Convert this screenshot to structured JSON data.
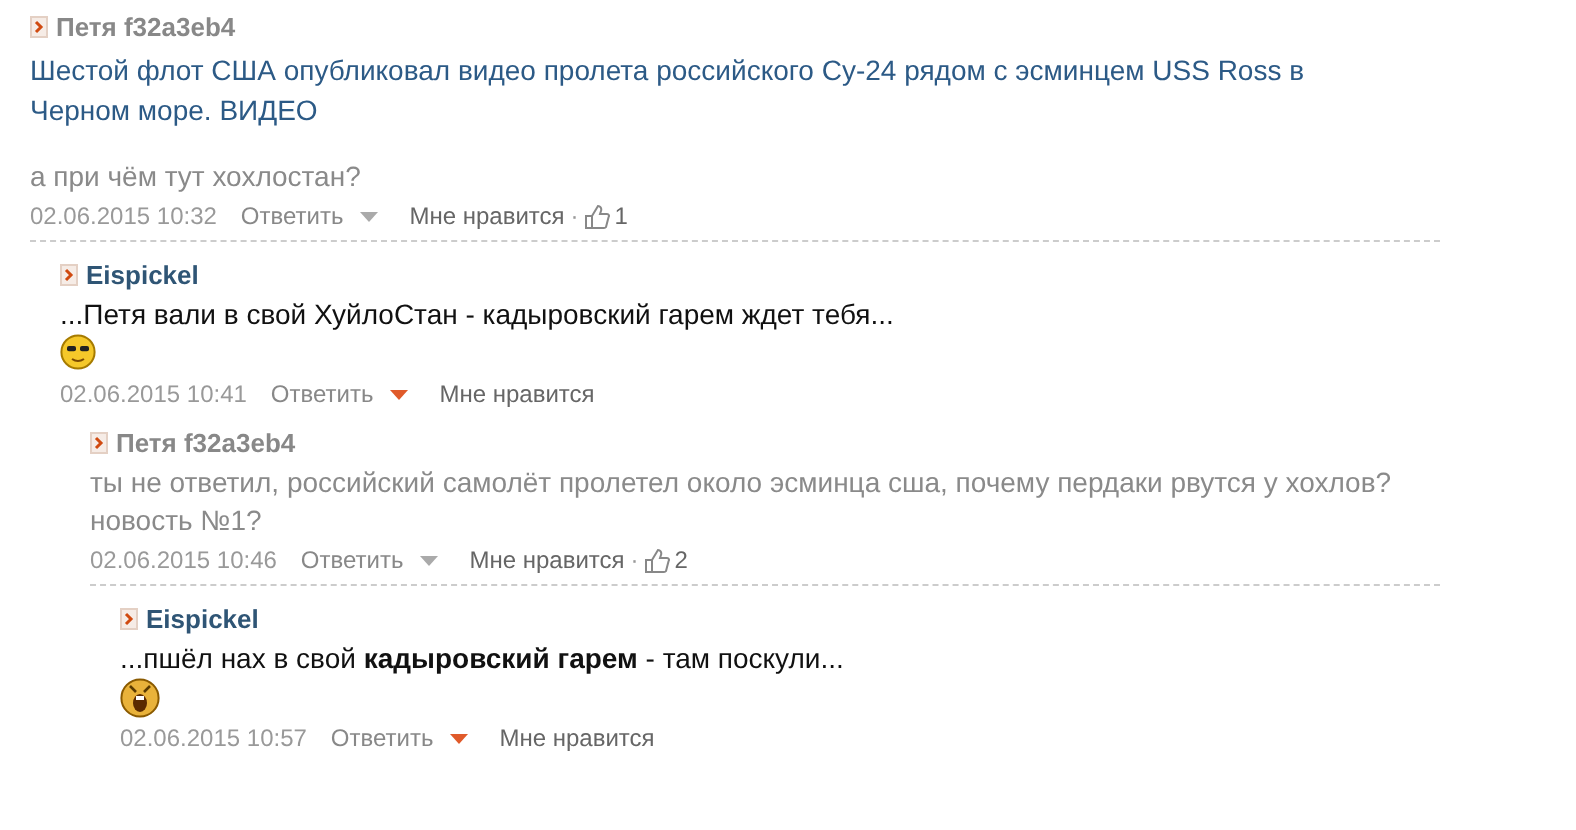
{
  "comments": [
    {
      "kind": "guest",
      "author": "Петя f32a3eb4",
      "link": "Шестой флот США опубликовал видео пролета российского Су-24 рядом с эсминцем USS Ross в Черном море. ВИДЕО",
      "text": "а при чём тут хохлостан?",
      "time": "02.06.2015 10:32",
      "reply": "Ответить",
      "like": "Мне нравится",
      "separator": "·",
      "likes": "1",
      "children": [
        {
          "kind": "member",
          "author": "Eispickel",
          "text": "...Петя вали в свой ХуйлоСтан - кадыровский гарем ждет тебя...",
          "smiley": {
            "kind": "cool"
          },
          "time": "02.06.2015 10:41",
          "reply": "Ответить",
          "like": "Мне нравится",
          "children": [
            {
              "kind": "guest",
              "author": "Петя f32a3eb4",
              "text": "ты не ответил, российский самолёт пролетел около эсминца сша, почему пердаки рвутся у хохлов? новость №1?",
              "time": "02.06.2015 10:46",
              "reply": "Ответить",
              "like": "Мне нравится",
              "separator": "·",
              "likes": "2",
              "children": [
                {
                  "kind": "member",
                  "author": "Eispickel",
                  "text": "...пшёл нах в свой **кадыровский гарем** - там поскули...",
                  "smiley": {
                    "kind": "scream"
                  },
                  "time": "02.06.2015 10:57",
                  "reply": "Ответить",
                  "like": "Мне нравится"
                }
              ]
            }
          ]
        }
      ]
    }
  ]
}
